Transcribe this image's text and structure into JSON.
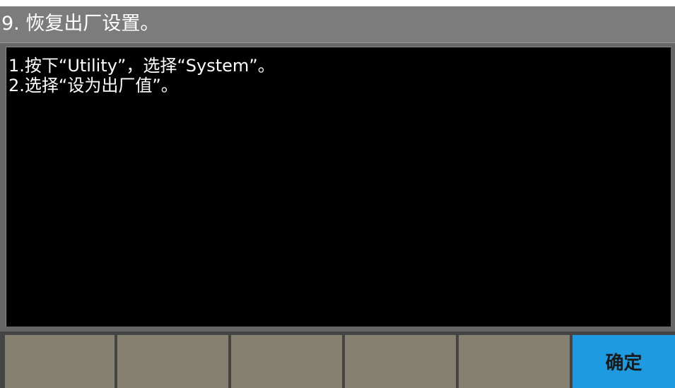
{
  "title": "9. 恢复出厂设置。",
  "instructions": [
    "1.按下“Utility”，选择“System”。",
    "2.选择“设为出厂值”。"
  ],
  "softkeys": [
    "",
    "",
    "",
    "",
    "",
    "确定"
  ],
  "colors": {
    "title_bar": "#7c7c7c",
    "content_bg": "#000000",
    "softkey": "#868070",
    "softkey_active": "#1e9be0"
  }
}
